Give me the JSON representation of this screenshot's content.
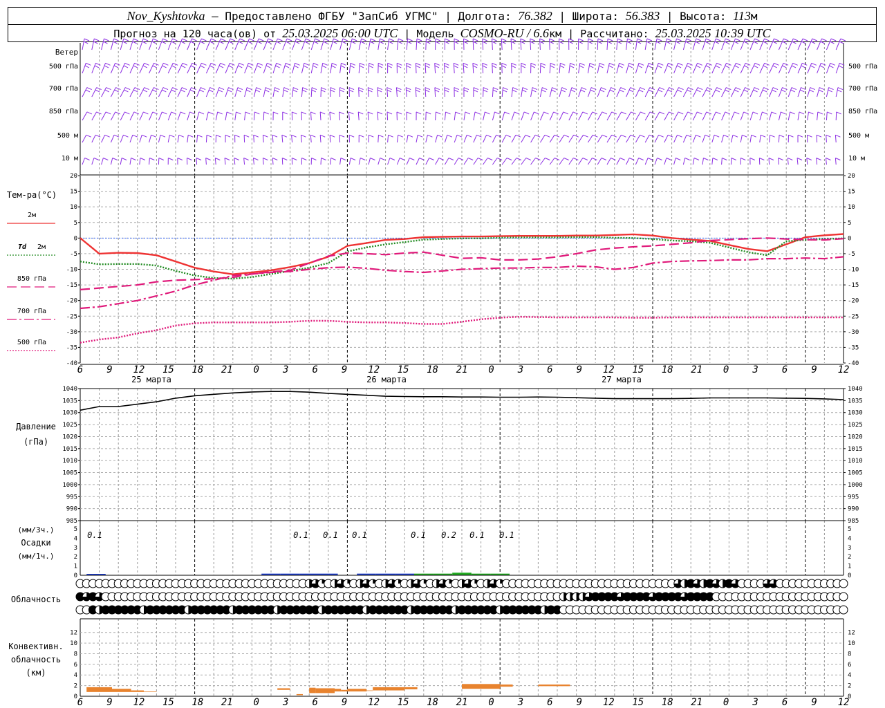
{
  "header": {
    "line1": [
      {
        "t": "Nov_Kyshtovka",
        "i": true
      },
      {
        "t": " — Предоставлено ФГБУ \"ЗапСиб УГМС\" | Долгота: ",
        "i": false
      },
      {
        "t": "76.382",
        "i": true
      },
      {
        "t": " | Широта: ",
        "i": false
      },
      {
        "t": "56.383",
        "i": true
      },
      {
        "t": " | Высота: ",
        "i": false
      },
      {
        "t": "113",
        "i": true
      },
      {
        "t": "м",
        "i": false
      }
    ],
    "line2": [
      {
        "t": "Прогноз на 120 часа(ов) от ",
        "i": false
      },
      {
        "t": "25.03.2025 06:00 UTC",
        "i": true
      },
      {
        "t": " | Модель ",
        "i": false
      },
      {
        "t": "COSMO-RU / 6.6",
        "i": true
      },
      {
        "t": "км | Рассчитано: ",
        "i": false
      },
      {
        "t": "25.03.2025 10:39 UTC",
        "i": true
      }
    ]
  },
  "x_axis": {
    "hours": [
      "6",
      "9",
      "12",
      "15",
      "18",
      "21",
      "0",
      "3",
      "6",
      "9",
      "12",
      "15",
      "18",
      "21",
      "0",
      "3",
      "6",
      "9",
      "12",
      "15",
      "18",
      "21",
      "0",
      "3",
      "6",
      "9",
      "12"
    ],
    "days": [
      "25 марта",
      "26 марта",
      "27 марта"
    ]
  },
  "wind_panel": {
    "title": "Ветер",
    "levels": [
      "500 гПа",
      "700 гПа",
      "850 гПа",
      "500 м",
      "10 м"
    ],
    "color": "#8a2be2"
  },
  "temp_panel": {
    "title": "Тем-ра(°С)",
    "ticks": [
      "20",
      "15",
      "10",
      "5",
      "0",
      "-5",
      "-10",
      "-15",
      "-20",
      "-25",
      "-30",
      "-35",
      "-40"
    ],
    "legend": [
      {
        "label": "2м",
        "color": "#ee3333",
        "dash": "solid"
      },
      {
        "label": "Td",
        "label2": "2м",
        "color": "#228b22",
        "dash": "dot"
      },
      {
        "label": "850 гПа",
        "color": "#e0197a",
        "dash": "long"
      },
      {
        "label": "700 гПа",
        "color": "#e0197a",
        "dash": "dashdot"
      },
      {
        "label": "500 гПа",
        "color": "#e0197a",
        "dash": "dot"
      }
    ]
  },
  "pressure_panel": {
    "title1": "Давление",
    "title2": "(гПа)",
    "ticks": [
      "1040",
      "1035",
      "1030",
      "1025",
      "1020",
      "1015",
      "1010",
      "1005",
      "1000",
      "995",
      "990",
      "985"
    ]
  },
  "precip_panel": {
    "title1": "(мм/3ч.)",
    "title2": "Осадки",
    "title3": "(мм/1ч.)",
    "ticks": [
      "5",
      "4",
      "3",
      "2",
      "1",
      "0"
    ],
    "labels": [
      "0.1",
      "0.1",
      "0.1",
      "0.1",
      "0.1",
      "0.2",
      "0.1",
      "0.1"
    ]
  },
  "cloud_panel": {
    "title": "Облачность"
  },
  "conv_panel": {
    "title1": "Конвективн.",
    "title2": "облачность",
    "title3": "(км)",
    "ticks": [
      "12",
      "10",
      "8",
      "6",
      "4",
      "2",
      "0"
    ]
  },
  "chart_data": [
    {
      "type": "line",
      "title": "Тем-ра(°С)",
      "x": [
        0,
        3,
        6,
        9,
        12,
        15,
        18,
        21,
        24,
        27,
        30,
        33,
        36,
        39,
        42,
        45,
        48,
        51,
        54,
        57,
        60,
        63,
        66,
        69,
        72,
        75,
        78,
        81,
        84,
        87,
        90,
        93,
        96,
        99,
        102,
        105,
        108,
        111,
        114,
        117,
        120
      ],
      "ylim": [
        -40,
        20
      ],
      "series": [
        {
          "name": "2м",
          "values": [
            0,
            -5,
            -4.7,
            -4.8,
            -5.5,
            -7.5,
            -9.5,
            -10.7,
            -11.6,
            -11,
            -10.3,
            -9.3,
            -8,
            -6,
            -2.5,
            -1.6,
            -0.6,
            -0.3,
            0.3,
            0.4,
            0.5,
            0.5,
            0.6,
            0.7,
            0.7,
            0.7,
            0.8,
            0.8,
            1,
            1.2,
            0.8,
            0,
            -0.5,
            -0.9,
            -2.2,
            -3.5,
            -4.2,
            -2,
            0.3,
            0.9,
            1.3
          ]
        },
        {
          "name": "Td 2м",
          "values": [
            -7.5,
            -8.4,
            -8.3,
            -8.3,
            -8.8,
            -10.5,
            -12,
            -12.8,
            -13,
            -12.5,
            -11.5,
            -10.5,
            -9.5,
            -8,
            -4.3,
            -3,
            -2,
            -1.3,
            -0.5,
            -0.3,
            -0.1,
            -0.1,
            0.1,
            0.2,
            0.2,
            0.2,
            0.3,
            0.3,
            0.1,
            0,
            -0.3,
            -0.8,
            -1,
            -1.5,
            -3,
            -4.5,
            -5.5,
            -1,
            -0.6,
            -0.3,
            -0.1
          ]
        },
        {
          "name": "850 гПа",
          "values": [
            -16.5,
            -16,
            -15.5,
            -15,
            -14,
            -13.5,
            -13.3,
            -13,
            -12.6,
            -11.5,
            -10.8,
            -10.3,
            -8,
            -5.8,
            -4.8,
            -5,
            -5.3,
            -4.8,
            -4.5,
            -5.5,
            -6.5,
            -6.3,
            -7,
            -7,
            -6.7,
            -6,
            -5,
            -3.8,
            -3.2,
            -2.8,
            -2.5,
            -2,
            -1.5,
            -0.8,
            -0.5,
            -0.2,
            0,
            -0.3,
            -0.5,
            -0.6,
            -0.2
          ]
        },
        {
          "name": "700 гПа",
          "values": [
            -22.5,
            -22,
            -21,
            -20,
            -18.5,
            -17,
            -15,
            -13.5,
            -12,
            -11.5,
            -11,
            -10.7,
            -10,
            -9.5,
            -9.3,
            -9.7,
            -10.3,
            -10.7,
            -11,
            -10.5,
            -10,
            -9.8,
            -9.6,
            -9.6,
            -9.4,
            -9.4,
            -9,
            -9.2,
            -10,
            -9.4,
            -8,
            -7.5,
            -7.3,
            -7.2,
            -7,
            -7,
            -6.6,
            -6.6,
            -6.4,
            -6.6,
            -6
          ]
        },
        {
          "name": "500 гПа",
          "values": [
            -33.5,
            -32.5,
            -31.8,
            -30.5,
            -29.5,
            -28,
            -27.3,
            -27,
            -27,
            -27,
            -27,
            -26.8,
            -26.5,
            -26.5,
            -26.8,
            -27,
            -27,
            -27.2,
            -27.5,
            -27.5,
            -26.8,
            -26,
            -25.5,
            -25.2,
            -25.3,
            -25.4,
            -25.4,
            -25.4,
            -25.4,
            -25.5,
            -25.5,
            -25.4,
            -25.4,
            -25.4,
            -25.4,
            -25.4,
            -25.4,
            -25.4,
            -25.4,
            -25.4,
            -25.4
          ]
        }
      ]
    },
    {
      "type": "line",
      "title": "Давление (гПа)",
      "x": [
        0,
        3,
        6,
        9,
        12,
        15,
        18,
        21,
        24,
        27,
        30,
        33,
        36,
        39,
        42,
        45,
        48,
        51,
        54,
        57,
        60,
        63,
        66,
        69,
        72,
        75,
        78,
        81,
        84,
        87,
        90,
        93,
        96,
        99,
        102,
        105,
        108,
        111,
        114,
        117,
        120
      ],
      "ylim": [
        985,
        1040
      ],
      "series": [
        {
          "name": "Давление",
          "values": [
            1031,
            1032.5,
            1032.5,
            1033.5,
            1034.5,
            1036,
            1037,
            1037.6,
            1038.2,
            1038.6,
            1038.8,
            1038.8,
            1038.5,
            1038,
            1037.6,
            1037.2,
            1036.8,
            1036.7,
            1036.6,
            1036.6,
            1036.5,
            1036.5,
            1036.4,
            1036.4,
            1036.5,
            1036.4,
            1036.2,
            1036,
            1035.8,
            1035.8,
            1035.8,
            1035.8,
            1035.9,
            1036.1,
            1036.1,
            1036.1,
            1036.1,
            1036,
            1035.9,
            1035.7,
            1035.4
          ]
        }
      ]
    },
    {
      "type": "bar",
      "title": "Осадки",
      "x_mm3h": [
        30,
        33,
        36,
        39,
        45,
        48,
        51,
        54,
        57,
        60,
        63,
        66
      ],
      "values_mm3h": [
        0.1,
        0.1,
        0.1,
        0.1,
        0.1,
        0.1,
        0.1,
        0.1,
        0.1,
        0.2,
        0.1,
        0.1
      ],
      "x_mm1h": [
        1,
        2,
        3
      ],
      "values_mm1h": [
        0.05,
        0.05,
        0.05
      ],
      "ylim": [
        0,
        5
      ]
    },
    {
      "type": "heatmap",
      "title": "Облачность",
      "rows": 3,
      "x_step_hours": 1
    },
    {
      "type": "bar",
      "title": "Конвективн. облачность (км)",
      "segments": [
        {
          "from": 1,
          "to": 5,
          "base": 0.8,
          "top": 1.7
        },
        {
          "from": 5,
          "to": 8,
          "base": 0.8,
          "top": 1.4
        },
        {
          "from": 8,
          "to": 10,
          "base": 0.8,
          "top": 1.1
        },
        {
          "from": 10,
          "to": 12,
          "base": 0.8,
          "top": 0.9
        },
        {
          "from": 31,
          "to": 33,
          "base": 1.2,
          "top": 1.5
        },
        {
          "from": 34,
          "to": 35,
          "base": 0.2,
          "top": 0.4
        },
        {
          "from": 36,
          "to": 37,
          "base": 0.6,
          "top": 1.6
        },
        {
          "from": 37,
          "to": 40,
          "base": 0.6,
          "top": 1.5
        },
        {
          "from": 40,
          "to": 41,
          "base": 0.9,
          "top": 1.4
        },
        {
          "from": 41,
          "to": 42,
          "base": 0.9,
          "top": 1.2
        },
        {
          "from": 42,
          "to": 45,
          "base": 0.9,
          "top": 1.4
        },
        {
          "from": 45,
          "to": 46,
          "base": 1.0,
          "top": 1.1
        },
        {
          "from": 46,
          "to": 51,
          "base": 1.1,
          "top": 1.7
        },
        {
          "from": 51,
          "to": 53,
          "base": 1.3,
          "top": 1.7
        },
        {
          "from": 60,
          "to": 66,
          "base": 1.4,
          "top": 2.3
        },
        {
          "from": 66,
          "to": 68,
          "base": 1.8,
          "top": 2.2
        },
        {
          "from": 72,
          "to": 77,
          "base": 1.9,
          "top": 2.2
        }
      ],
      "ylim": [
        0,
        13
      ]
    }
  ]
}
